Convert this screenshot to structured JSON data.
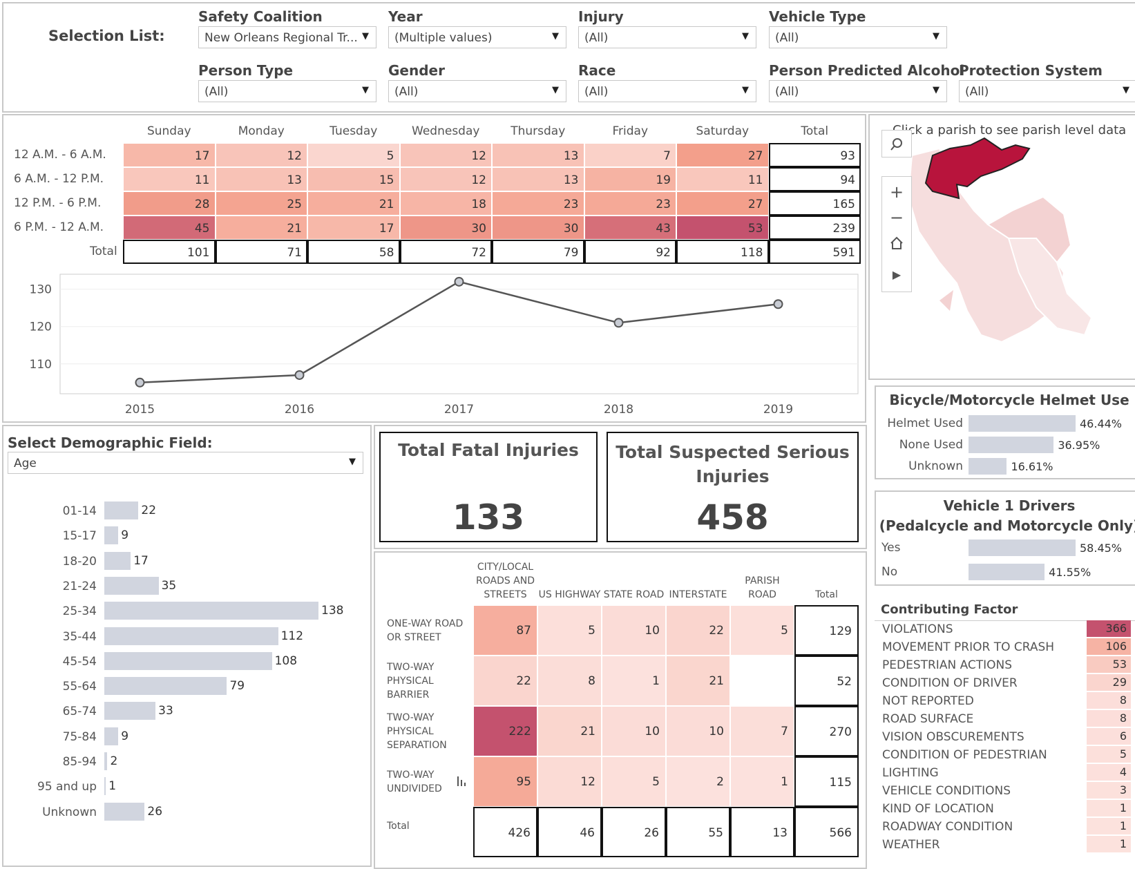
{
  "filters": {
    "heading": "Selection List:",
    "items": [
      {
        "label": "Safety Coalition",
        "value": "New Orleans Regional Tr..."
      },
      {
        "label": "Year",
        "value": "(Multiple values)"
      },
      {
        "label": "Injury",
        "value": "(All)"
      },
      {
        "label": "Vehicle Type",
        "value": "(All)"
      },
      {
        "label": "Person Type",
        "value": "(All)"
      },
      {
        "label": "Gender",
        "value": "(All)"
      },
      {
        "label": "Race",
        "value": "(All)"
      },
      {
        "label": "Person Predicted Alcohol",
        "value": "(All)"
      },
      {
        "label": "Protection System",
        "value": "(All)"
      }
    ]
  },
  "time_table": {
    "columns": [
      "Sunday",
      "Monday",
      "Tuesday",
      "Wednesday",
      "Thursday",
      "Friday",
      "Saturday",
      "Total"
    ],
    "rows": [
      {
        "label": "12 A.M. - 6 A.M.",
        "values": [
          "17",
          "12",
          "5",
          "12",
          "13",
          "7",
          "27"
        ],
        "total": "93"
      },
      {
        "label": "6 A.M. - 12 P.M.",
        "values": [
          "11",
          "13",
          "15",
          "12",
          "13",
          "19",
          "11"
        ],
        "total": "94"
      },
      {
        "label": "12 P.M. - 6 P.M.",
        "values": [
          "28",
          "25",
          "21",
          "18",
          "23",
          "23",
          "27"
        ],
        "total": "165"
      },
      {
        "label": "6 P.M. - 12 A.M.",
        "values": [
          "45",
          "21",
          "17",
          "30",
          "30",
          "43",
          "53"
        ],
        "total": "239"
      }
    ],
    "total_label": "Total",
    "totals": [
      "101",
      "71",
      "58",
      "72",
      "79",
      "92",
      "118",
      "591"
    ]
  },
  "chart_data": {
    "type": "line",
    "x": [
      "2015",
      "2016",
      "2017",
      "2018",
      "2019"
    ],
    "series": [
      {
        "values": [
          105,
          107,
          132,
          121,
          126
        ]
      }
    ],
    "ylim": [
      102,
      134
    ],
    "yticks": [
      "110",
      "120",
      "130"
    ],
    "grid": true
  },
  "map": {
    "hint": "Click a parish to see parish level data",
    "highlight_color": "#b8143c"
  },
  "demographic": {
    "label": "Select Demographic Field:",
    "selected": "Age",
    "bars": [
      {
        "label": "01-14",
        "value": 22
      },
      {
        "label": "15-17",
        "value": 9
      },
      {
        "label": "18-20",
        "value": 17
      },
      {
        "label": "21-24",
        "value": 35
      },
      {
        "label": "25-34",
        "value": 138
      },
      {
        "label": "35-44",
        "value": 112
      },
      {
        "label": "45-54",
        "value": 108
      },
      {
        "label": "55-64",
        "value": 79
      },
      {
        "label": "65-74",
        "value": 33
      },
      {
        "label": "75-84",
        "value": 9
      },
      {
        "label": "85-94",
        "value": 2
      },
      {
        "label": "95 and up",
        "value": 1
      },
      {
        "label": "Unknown",
        "value": 26
      }
    ]
  },
  "kpi": {
    "fatal_title": "Total Fatal Injuries",
    "fatal_value": "133",
    "serious_title_1": "Total Suspected Serious",
    "serious_title_2": "Injuries",
    "serious_value": "458"
  },
  "road_table": {
    "columns": [
      [
        "CITY/LOCAL",
        "ROADS AND",
        "STREETS"
      ],
      [
        "US HIGHWAY"
      ],
      [
        "STATE ROAD"
      ],
      [
        "INTERSTATE"
      ],
      [
        "PARISH",
        "ROAD"
      ],
      [
        "Total"
      ]
    ],
    "rows": [
      {
        "label": [
          "ONE-WAY ROAD",
          "OR STREET"
        ],
        "values": [
          "87",
          "5",
          "10",
          "22",
          "5"
        ],
        "total": "129"
      },
      {
        "label": [
          "TWO-WAY",
          "PHYSICAL",
          "BARRIER"
        ],
        "values": [
          "22",
          "8",
          "1",
          "21",
          ""
        ],
        "total": "52"
      },
      {
        "label": [
          "TWO-WAY",
          "PHYSICAL",
          "SEPARATION"
        ],
        "values": [
          "222",
          "21",
          "10",
          "10",
          "7"
        ],
        "total": "270"
      },
      {
        "label": [
          "TWO-WAY",
          "UNDIVIDED"
        ],
        "values": [
          "95",
          "12",
          "5",
          "2",
          "1"
        ],
        "total": "115"
      }
    ],
    "total_label": "Total",
    "totals": [
      "426",
      "46",
      "26",
      "55",
      "13",
      "566"
    ]
  },
  "helmet": {
    "title": "Bicycle/Motorcycle Helmet Use",
    "items": [
      {
        "label": "Helmet Used",
        "value": 46.44,
        "display": "46.44%"
      },
      {
        "label": "None Used",
        "value": 36.95,
        "display": "36.95%"
      },
      {
        "label": "Unknown",
        "value": 16.61,
        "display": "16.61%"
      }
    ]
  },
  "drivers": {
    "title_1": "Vehicle 1 Drivers",
    "title_2": "(Pedalcycle and Motorcycle Only)",
    "items": [
      {
        "label": "Yes",
        "value": 58.45,
        "display": "58.45%"
      },
      {
        "label": "No",
        "value": 41.55,
        "display": "41.55%"
      }
    ]
  },
  "contributing": {
    "title": "Contributing Factor",
    "items": [
      {
        "label": "VIOLATIONS",
        "value": "366"
      },
      {
        "label": "MOVEMENT PRIOR TO CRASH",
        "value": "106"
      },
      {
        "label": "PEDESTRIAN ACTIONS",
        "value": "53"
      },
      {
        "label": "CONDITION OF DRIVER",
        "value": "29"
      },
      {
        "label": "NOT REPORTED",
        "value": "8"
      },
      {
        "label": "ROAD SURFACE",
        "value": "8"
      },
      {
        "label": "VISION OBSCUREMENTS",
        "value": "6"
      },
      {
        "label": "CONDITION OF PEDESTRIAN",
        "value": "5"
      },
      {
        "label": "LIGHTING",
        "value": "4"
      },
      {
        "label": "VEHICLE CONDITIONS",
        "value": "3"
      },
      {
        "label": "KIND OF LOCATION",
        "value": "1"
      },
      {
        "label": "ROADWAY CONDITION",
        "value": "1"
      },
      {
        "label": "WEATHER",
        "value": "1"
      }
    ]
  }
}
